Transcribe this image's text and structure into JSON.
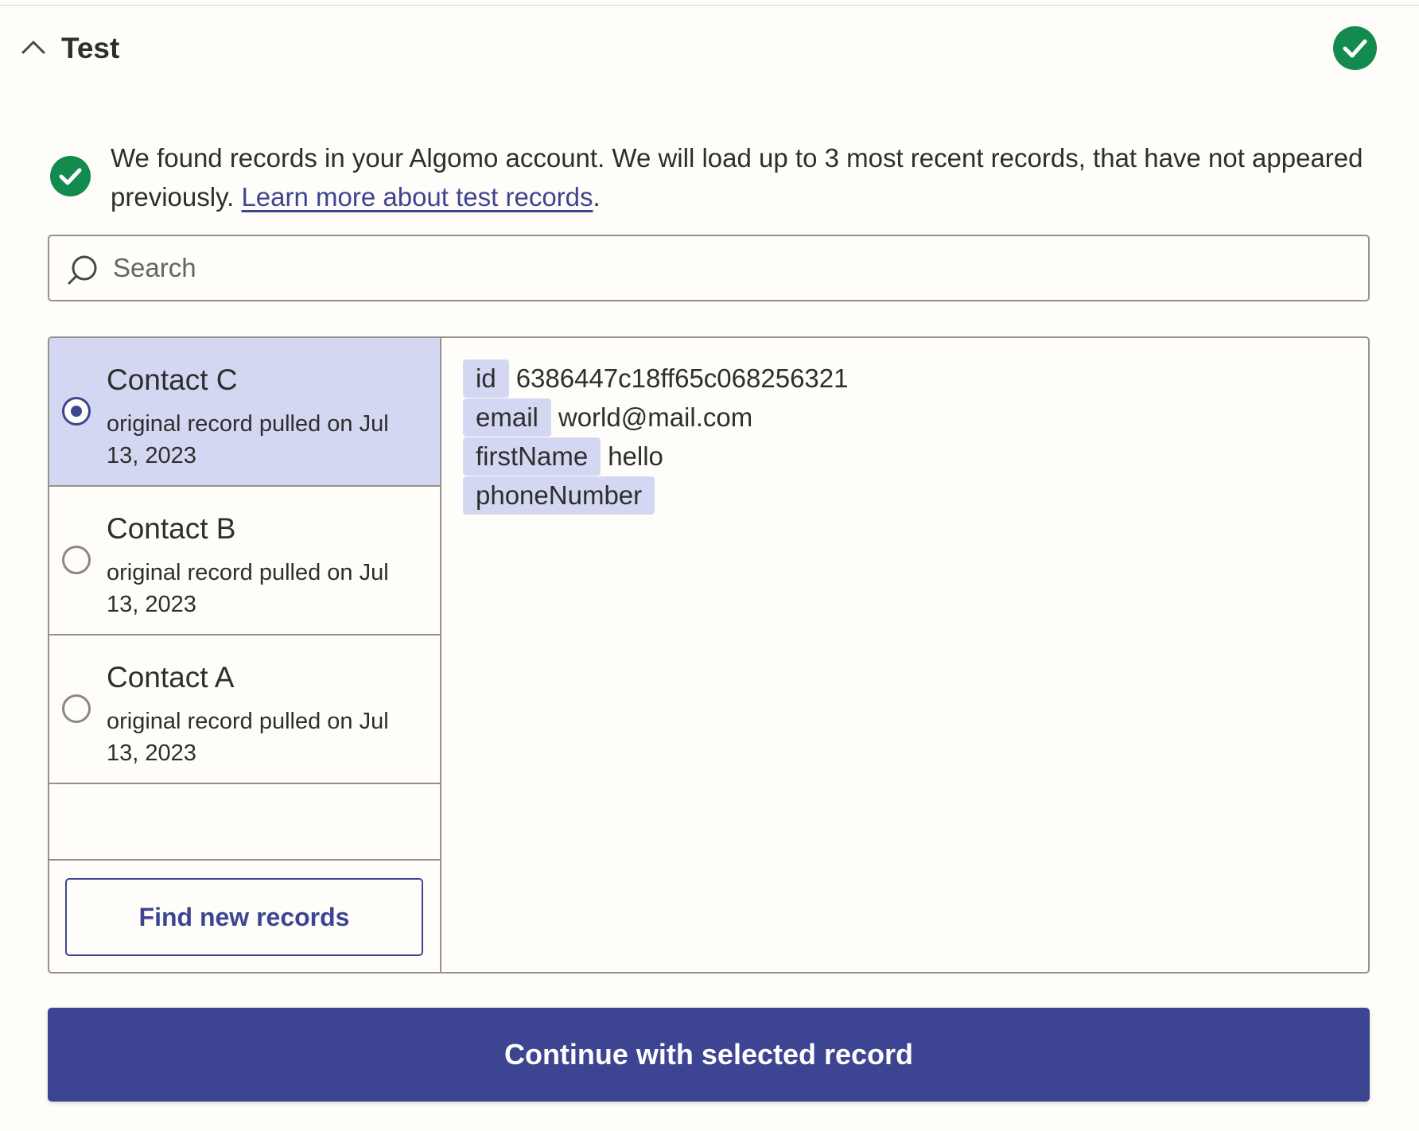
{
  "section": {
    "title": "Test",
    "status_icon": "check-circle-icon",
    "collapse_icon": "chevron-up-icon"
  },
  "info": {
    "message": "We found records in your Algomo account. We will load up to 3 most recent records, that have not appeared previously. ",
    "link_text": "Learn more about test records",
    "trailing": "."
  },
  "search": {
    "placeholder": "Search",
    "value": ""
  },
  "records": [
    {
      "name": "Contact C",
      "meta": "original record pulled on Jul 13, 2023",
      "selected": true
    },
    {
      "name": "Contact B",
      "meta": "original record pulled on Jul 13, 2023",
      "selected": false
    },
    {
      "name": "Contact A",
      "meta": "original record pulled on Jul 13, 2023",
      "selected": false
    }
  ],
  "find_button_label": "Find new records",
  "selected_record_fields": [
    {
      "key": "id",
      "value": "6386447c18ff65c068256321"
    },
    {
      "key": "email",
      "value": "world@mail.com"
    },
    {
      "key": "firstName",
      "value": "hello"
    },
    {
      "key": "phoneNumber",
      "value": ""
    }
  ],
  "continue_button_label": "Continue with selected record",
  "colors": {
    "accent": "#3d4592",
    "selected_bg": "#d3d7f2",
    "success": "#138a4e",
    "background": "#fffdf9",
    "border": "#95928e"
  }
}
